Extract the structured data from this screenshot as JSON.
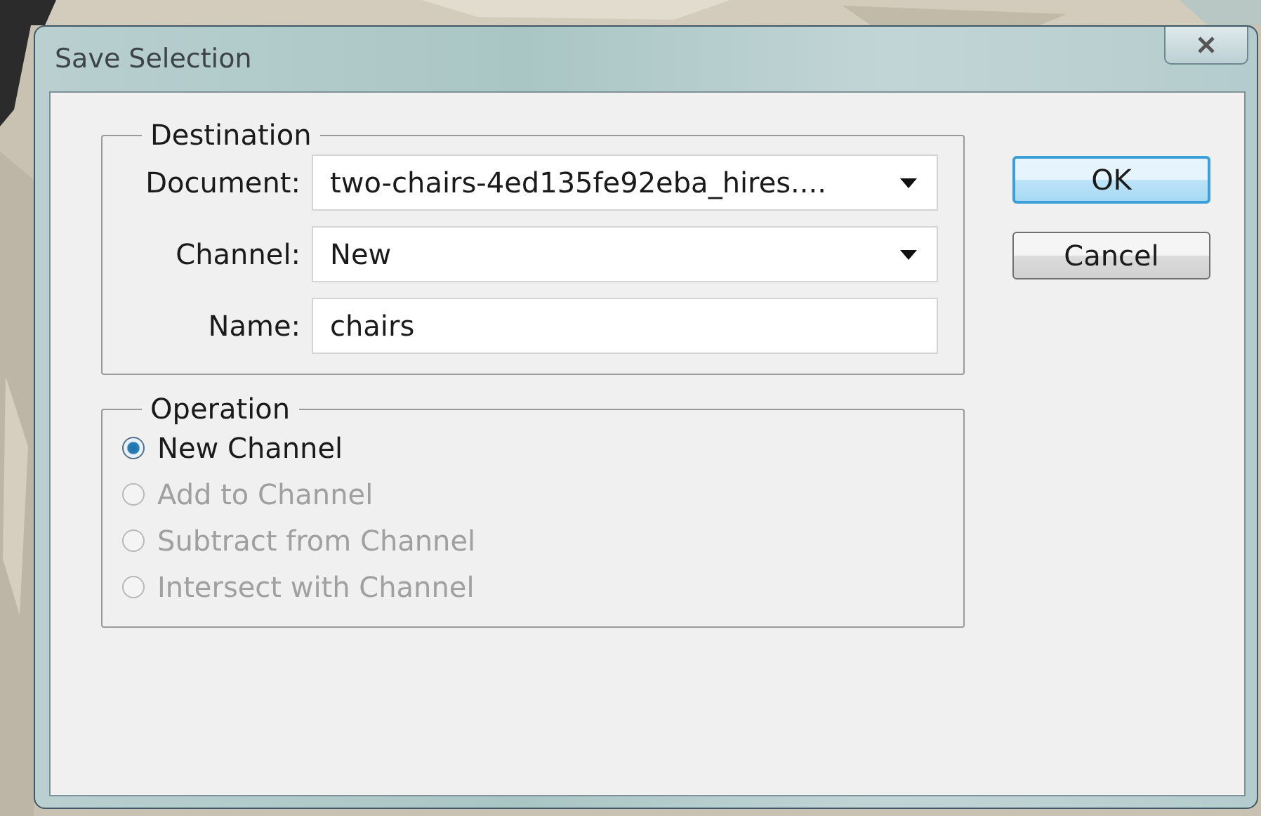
{
  "window": {
    "title": "Save Selection"
  },
  "destination": {
    "legend": "Destination",
    "fields": [
      {
        "label": "Document:",
        "kind": "dropdown",
        "value": "two-chairs-4ed135fe92eba_hires...."
      },
      {
        "label": "Channel:",
        "kind": "dropdown",
        "value": "New"
      },
      {
        "label": "Name:",
        "kind": "text",
        "value": "chairs"
      }
    ]
  },
  "operation": {
    "legend": "Operation",
    "options": [
      {
        "label": "New Channel",
        "selected": true,
        "disabled": false
      },
      {
        "label": "Add to Channel",
        "selected": false,
        "disabled": true
      },
      {
        "label": "Subtract from Channel",
        "selected": false,
        "disabled": true
      },
      {
        "label": "Intersect with Channel",
        "selected": false,
        "disabled": true
      }
    ]
  },
  "buttons": [
    {
      "label": "OK",
      "default": true
    },
    {
      "label": "Cancel",
      "default": false
    }
  ]
}
